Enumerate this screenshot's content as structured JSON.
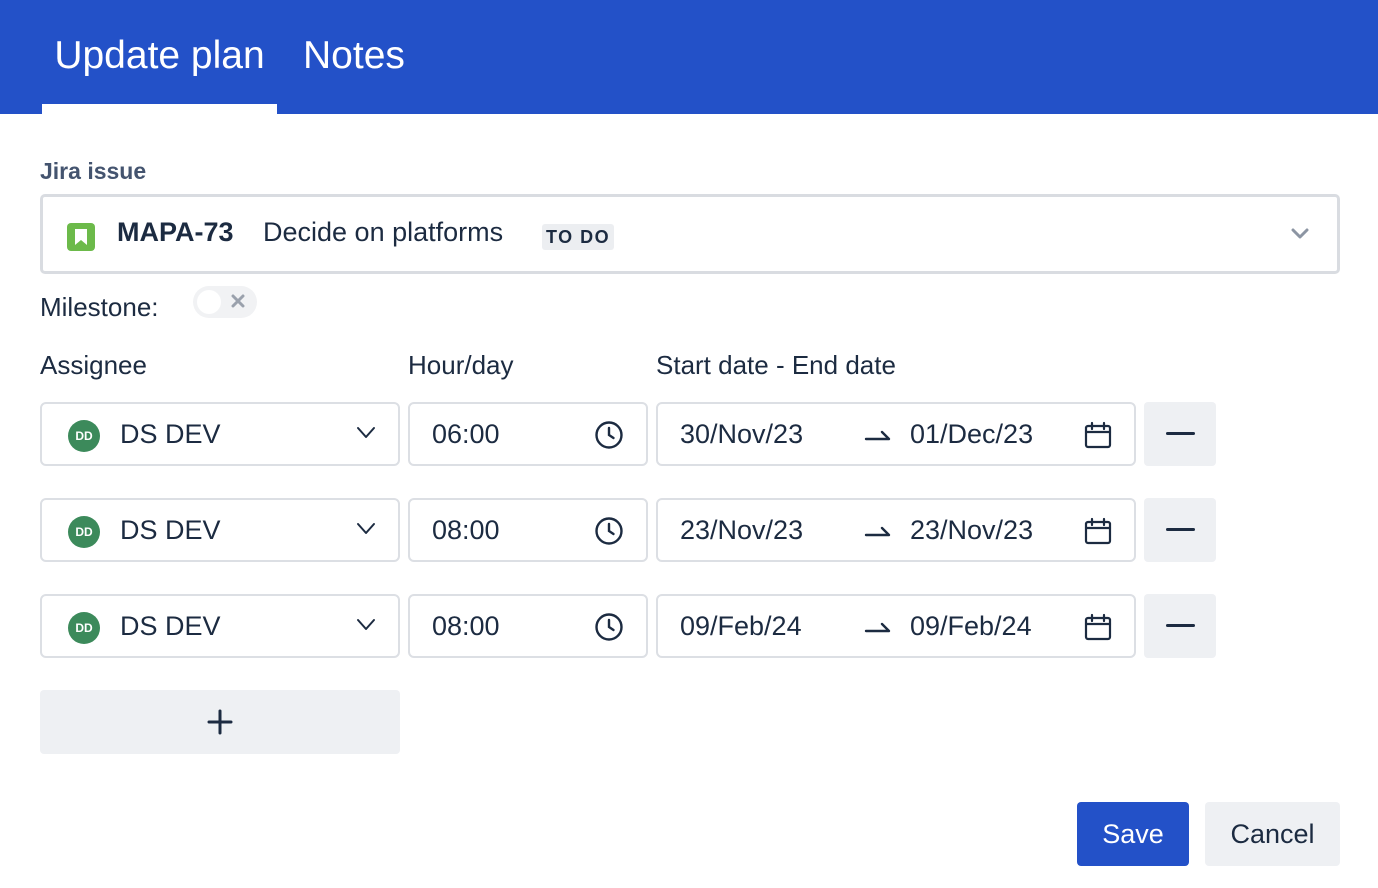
{
  "tabs": [
    {
      "label": "Update plan",
      "active": true
    },
    {
      "label": "Notes",
      "active": false
    }
  ],
  "jira_issue": {
    "label": "Jira issue",
    "key": "MAPA-73",
    "summary": "Decide on platforms",
    "status": "TO DO",
    "icon": "story-bookmark-icon"
  },
  "milestone": {
    "label": "Milestone:",
    "enabled": false
  },
  "columns": {
    "assignee": "Assignee",
    "hours": "Hour/day",
    "dates": "Start date - End date"
  },
  "rows": [
    {
      "avatar": "DD",
      "assignee": "DS DEV",
      "hours": "06:00",
      "start": "30/Nov/23",
      "end": "01/Dec/23"
    },
    {
      "avatar": "DD",
      "assignee": "DS DEV",
      "hours": "08:00",
      "start": "23/Nov/23",
      "end": "23/Nov/23"
    },
    {
      "avatar": "DD",
      "assignee": "DS DEV",
      "hours": "08:00",
      "start": "09/Feb/24",
      "end": "09/Feb/24"
    }
  ],
  "actions": {
    "save": "Save",
    "cancel": "Cancel"
  },
  "colors": {
    "primary": "#2351c8",
    "avatar": "#3c8a5b",
    "issue_icon": "#6cba4a"
  }
}
